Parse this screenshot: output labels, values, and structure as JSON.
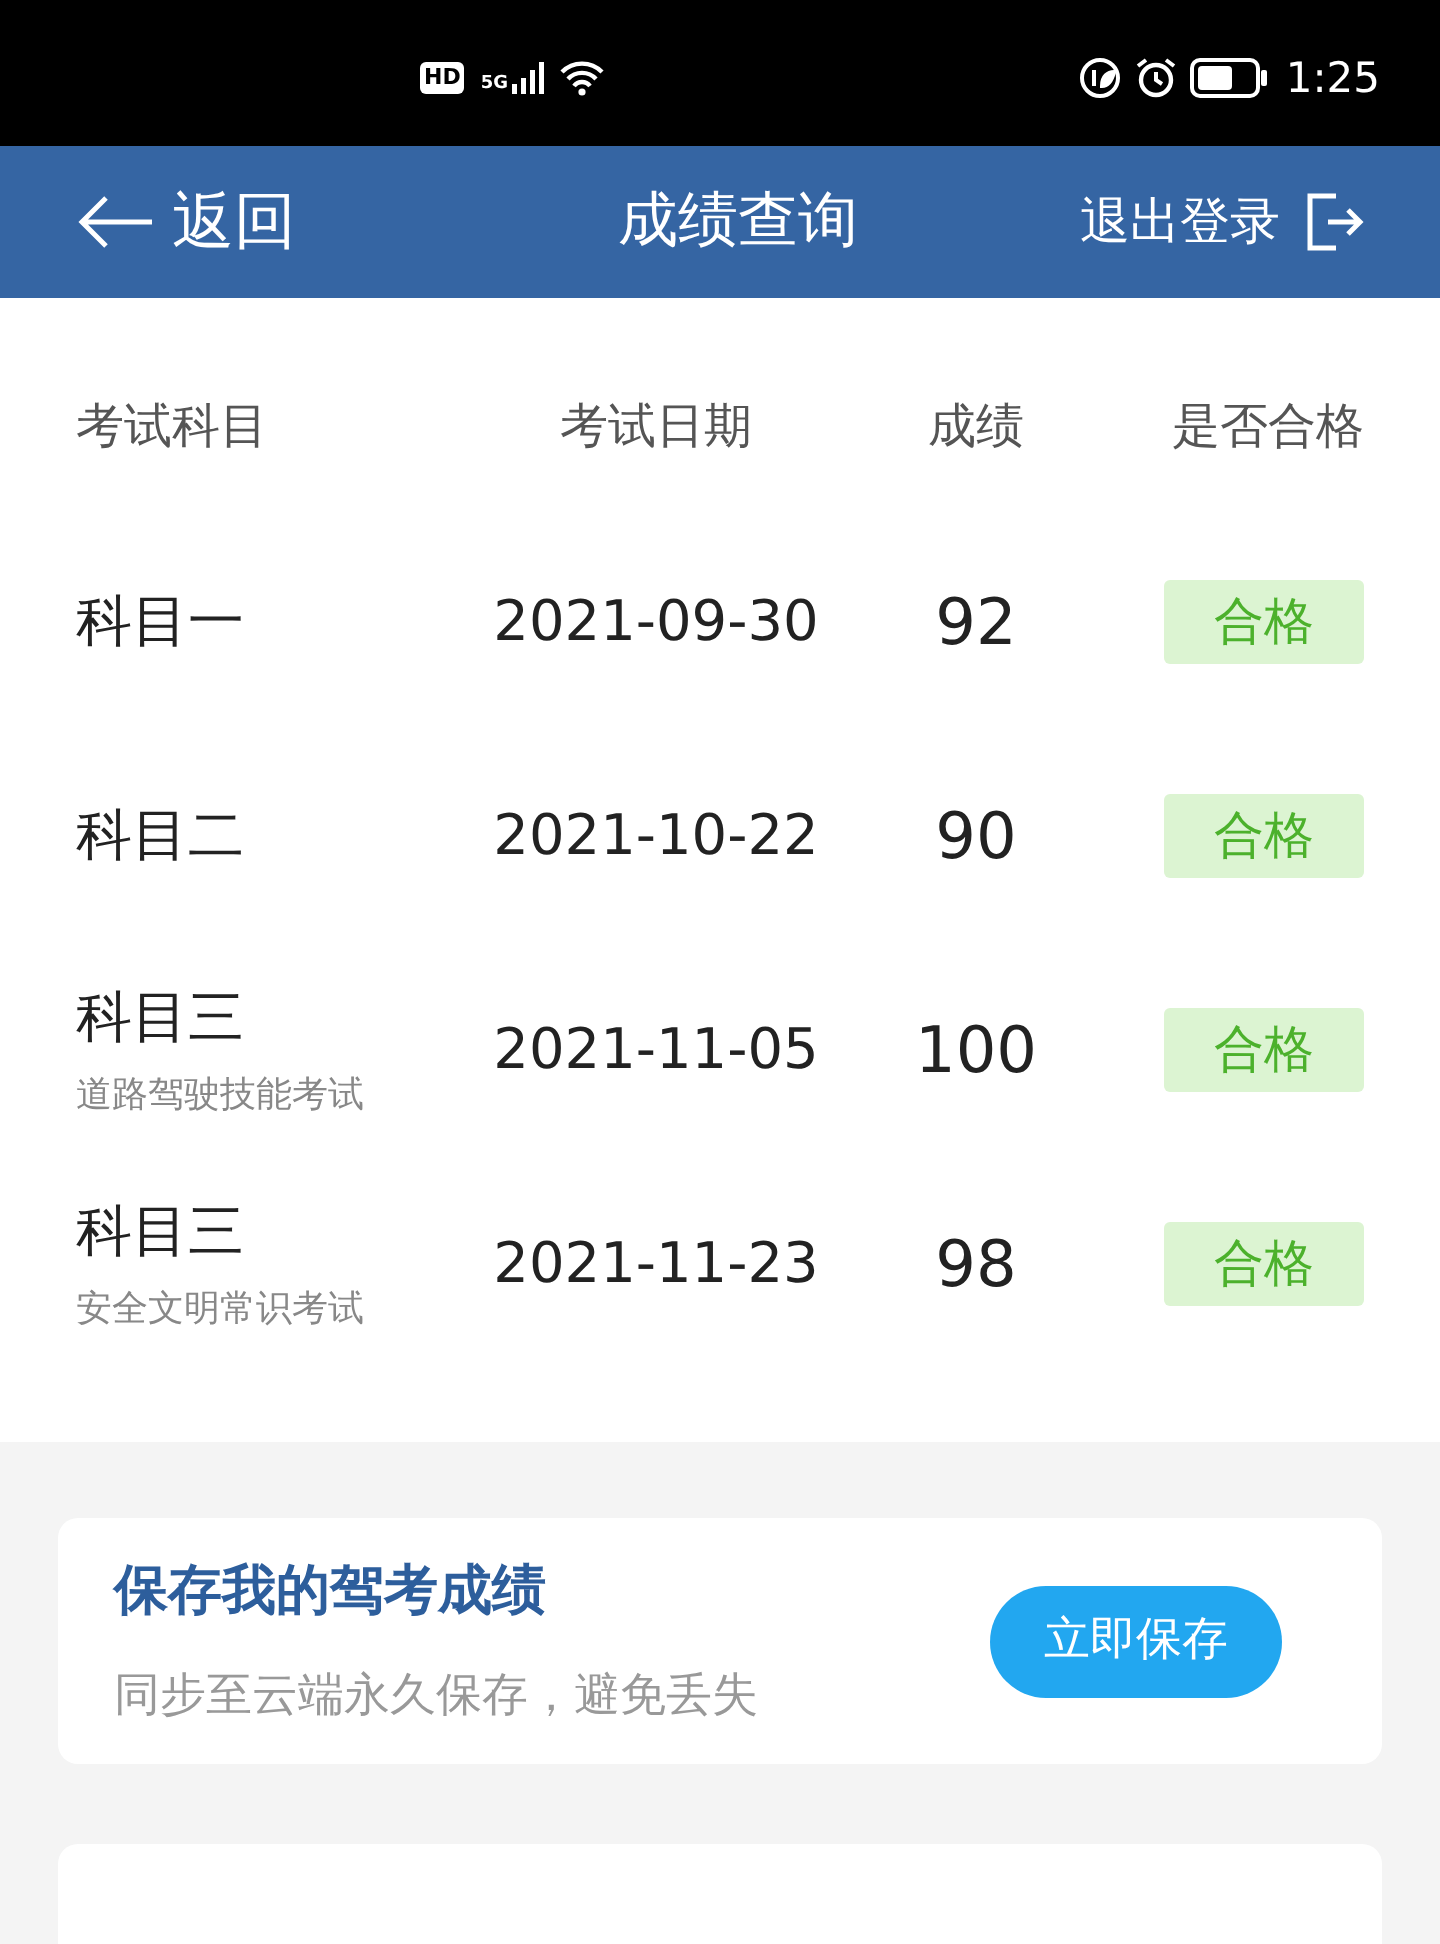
{
  "status_bar": {
    "hd": "HD",
    "network": "5G",
    "time": "1:25"
  },
  "header": {
    "back": "返回",
    "title": "成绩查询",
    "logout": "退出登录"
  },
  "table": {
    "columns": [
      "考试科目",
      "考试日期",
      "成绩",
      "是否合格"
    ],
    "rows": [
      {
        "subject": "科目一",
        "note": null,
        "date": "2021-09-30",
        "score": "92",
        "result": "合格",
        "passed": true
      },
      {
        "subject": "科目二",
        "note": null,
        "date": "2021-10-22",
        "score": "90",
        "result": "合格",
        "passed": true
      },
      {
        "subject": "科目三",
        "note": "道路驾驶技能考试",
        "date": "2021-11-05",
        "score": "100",
        "result": "合格",
        "passed": true
      },
      {
        "subject": "科目三",
        "note": "安全文明常识考试",
        "date": "2021-11-23",
        "score": "98",
        "result": "合格",
        "passed": true
      }
    ]
  },
  "save_card": {
    "title": "保存我的驾考成绩",
    "subtitle": "同步至云端永久保存，避免丢失",
    "button": "立即保存"
  }
}
